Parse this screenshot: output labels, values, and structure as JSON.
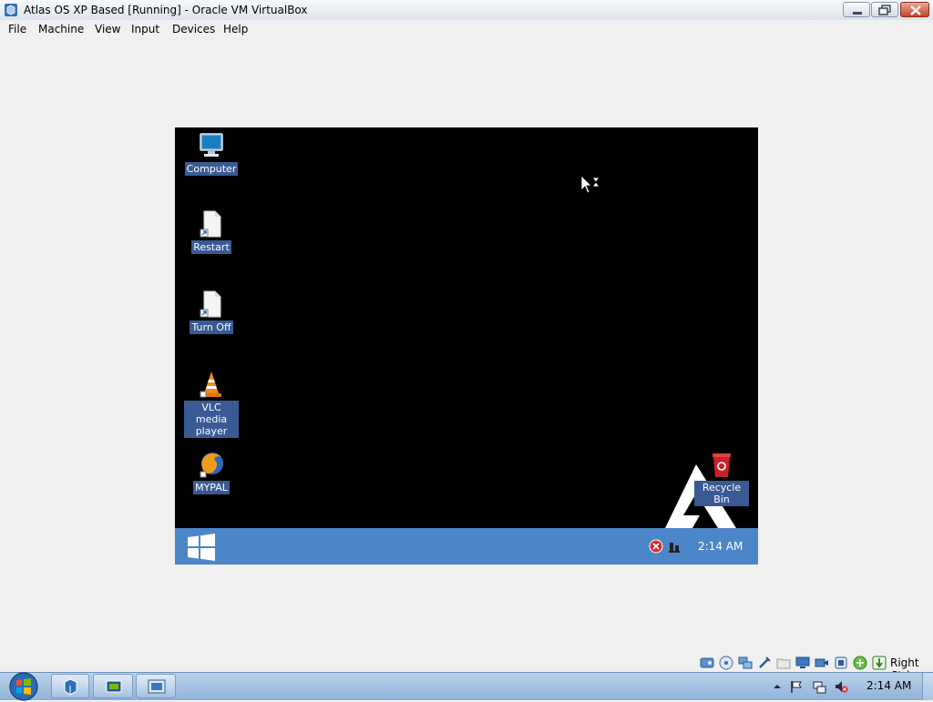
{
  "window": {
    "title": "Atlas OS XP Based [Running] - Oracle VM VirtualBox",
    "app_icon": "virtualbox-icon",
    "controls": [
      "minimize-icon",
      "maximize-icon",
      "close-icon"
    ]
  },
  "menubar": {
    "items": [
      "File",
      "Machine",
      "View",
      "Input",
      "Devices",
      "Help"
    ]
  },
  "vm": {
    "desktop_icons": [
      {
        "label": "Computer",
        "icon": "computer-icon"
      },
      {
        "label": "Restart",
        "icon": "shortcut-file-icon"
      },
      {
        "label": "Turn Off",
        "icon": "shortcut-file-icon"
      },
      {
        "label": "VLC media player",
        "icon": "vlc-icon"
      },
      {
        "label": "MYPAL",
        "icon": "mypal-browser-icon"
      },
      {
        "label": "Recycle Bin",
        "icon": "recycle-bin-icon"
      }
    ],
    "taskbar": {
      "start_icon": "windows-logo-icon",
      "tray_icons": [
        "error-icon",
        "network-icon"
      ],
      "clock": "2:14 AM"
    },
    "wallpaper_logo": "atlas-logo"
  },
  "vbox_status": {
    "icons": [
      "hard-disk-icon",
      "optical-drive-icon",
      "network-adapter-icon",
      "usb-icon",
      "shared-folders-icon",
      "display-icon",
      "recording-icon",
      "virtualization-icon",
      "mouse-integration-icon",
      "keyboard-icon"
    ],
    "host_key": "Right Ctrl"
  },
  "host_taskbar": {
    "start_icon": "windows-orb-icon",
    "buttons": [
      "virtualbox-manager-icon",
      "vm-window-icon",
      "vm-preview-icon"
    ],
    "tray_icons": [
      "show-hidden-icons-icon",
      "action-center-flag-icon",
      "network-tray-icon",
      "volume-muted-icon"
    ],
    "clock": "2:14 AM"
  },
  "colors": {
    "vm_taskbar": "#4d86c8",
    "icon_label_bg": "#3a5a94",
    "vm_background": "#000000",
    "host_background": "#f0f0f0"
  }
}
